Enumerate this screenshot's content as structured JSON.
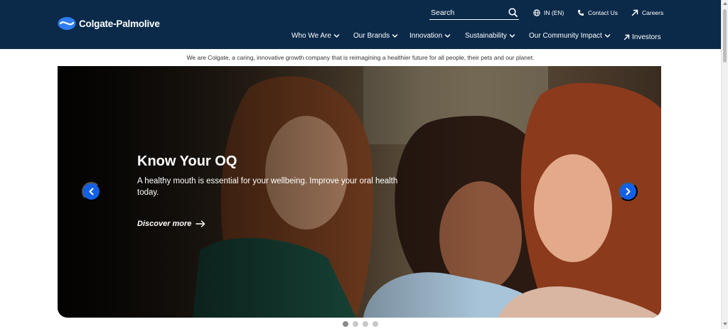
{
  "brand": {
    "name": "Colgate-Palmolive",
    "logo_icon": "colgate-logo-icon",
    "color_primary": "#0b2a4a",
    "color_accent": "#1360e8"
  },
  "search": {
    "placeholder": "Search",
    "icon": "search-icon"
  },
  "utility_nav": [
    {
      "label": "IN (EN)",
      "icon": "globe-icon"
    },
    {
      "label": "Contact Us",
      "icon": "phone-icon"
    },
    {
      "label": "Careers",
      "icon": "arrow-up-right-icon"
    }
  ],
  "main_nav": [
    {
      "label": "Who We Are",
      "icon": "chevron-down-icon"
    },
    {
      "label": "Our Brands",
      "icon": "chevron-down-icon"
    },
    {
      "label": "Innovation",
      "icon": "chevron-down-icon"
    },
    {
      "label": "Sustainability",
      "icon": "chevron-down-icon"
    },
    {
      "label": "Our Community Impact",
      "icon": "chevron-down-icon"
    },
    {
      "label": "Investors",
      "icon": "arrow-up-right-icon"
    }
  ],
  "tagline": "We are Colgate, a caring, innovative growth company that is reimagining a healthier future for all people, their pets and our planet.",
  "hero": {
    "title": "Know Your OQ",
    "subtitle": "A healthy mouth is essential for your wellbeing. Improve your oral health today.",
    "cta_label": "Discover more",
    "cta_icon": "arrow-right-icon",
    "prev_icon": "chevron-left-icon",
    "next_icon": "chevron-right-icon"
  },
  "carousel": {
    "slide_count": 4,
    "active_slide": 1
  }
}
